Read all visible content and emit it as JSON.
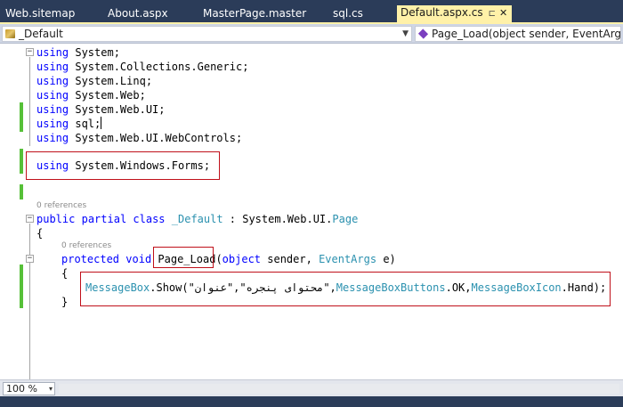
{
  "tabs": [
    {
      "label": "Web.sitemap"
    },
    {
      "label": "About.aspx"
    },
    {
      "label": "MasterPage.master"
    },
    {
      "label": "sql.cs"
    },
    {
      "label": "Default.aspx.cs",
      "pin": "⊏",
      "close": "✕",
      "active": true
    }
  ],
  "nav": {
    "type_combo": "_Default",
    "member_combo": "Page_Load(object sender, EventArgs e)"
  },
  "code": {
    "l1_kw": "using",
    "l1_rest": " System;",
    "l2_kw": "using",
    "l2_rest": " System.Collections.Generic;",
    "l3_kw": "using",
    "l3_rest": " System.Linq;",
    "l4_kw": "using",
    "l4_rest": " System.Web;",
    "l5_kw": "using",
    "l5_rest": " System.Web.UI;",
    "l6_kw": "using",
    "l6_rest": " sql;",
    "l7_kw": "using",
    "l7_rest": " System.Web.UI.WebControls;",
    "l8_kw": "using",
    "l8_rest": " System.Windows.Forms;",
    "ref1": "0 references",
    "l9_kw1": "public",
    "l9_kw2": "partial",
    "l9_kw3": "class",
    "l9_type": "_Default",
    "l9_mid": " : System.Web.UI.",
    "l9_base": "Page",
    "l10": "{",
    "ref2": "0 references",
    "l11_kw1": "protected",
    "l11_kw2": "void",
    "l11_method": "Page_Load",
    "l11_paren": "(",
    "l11_kw3": "object",
    "l11_mid": " sender, ",
    "l11_type": "EventArgs",
    "l11_end": " e)",
    "l12": "{",
    "l13_type1": "MessageBox",
    "l13_a": ".Show(\"محتوای پنجره\",\"عنوان\",",
    "l13_type2": "MessageBoxButtons",
    "l13_b": ".OK,",
    "l13_type3": "MessageBoxIcon",
    "l13_c": ".Hand);",
    "l14": "}"
  },
  "collapse_glyph": "−",
  "status": {
    "zoom": "100 %",
    "zoom_arrow": "▾"
  },
  "colors": {
    "keyword": "#0000ff",
    "type": "#2b91af",
    "highlight_box": "#c0101a",
    "change_bar": "#56c038"
  }
}
